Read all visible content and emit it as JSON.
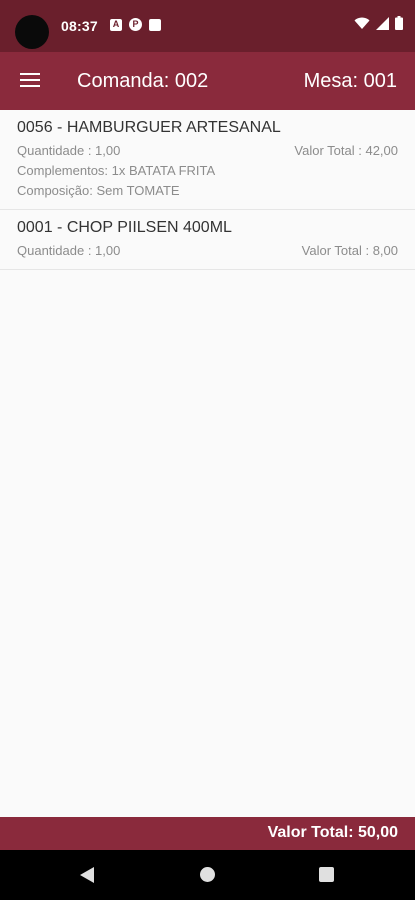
{
  "status_bar": {
    "time": "08:37",
    "icons_left": [
      "notification-a-icon",
      "notification-p-icon",
      "sim-card-icon"
    ],
    "icons_right": [
      "wifi-icon",
      "signal-icon",
      "battery-icon"
    ]
  },
  "app_bar": {
    "title": "Comanda: 002",
    "table": "Mesa: 001"
  },
  "items": [
    {
      "title": "0056 - HAMBURGUER ARTESANAL",
      "quantity": "Quantidade : 1,00",
      "total": "Valor Total : 42,00",
      "complements": "Complementos: 1x BATATA FRITA",
      "composition": "Composição: Sem TOMATE"
    },
    {
      "title": "0001 - CHOP PIILSEN 400ML",
      "quantity": "Quantidade : 1,00",
      "total": "Valor Total : 8,00"
    }
  ],
  "footer": {
    "total": "Valor Total: 50,00"
  },
  "colors": {
    "status_bar": "#6a1f2c",
    "primary": "#8a2a3c",
    "background": "#fafafa",
    "secondary_text": "#8c8c8c"
  }
}
